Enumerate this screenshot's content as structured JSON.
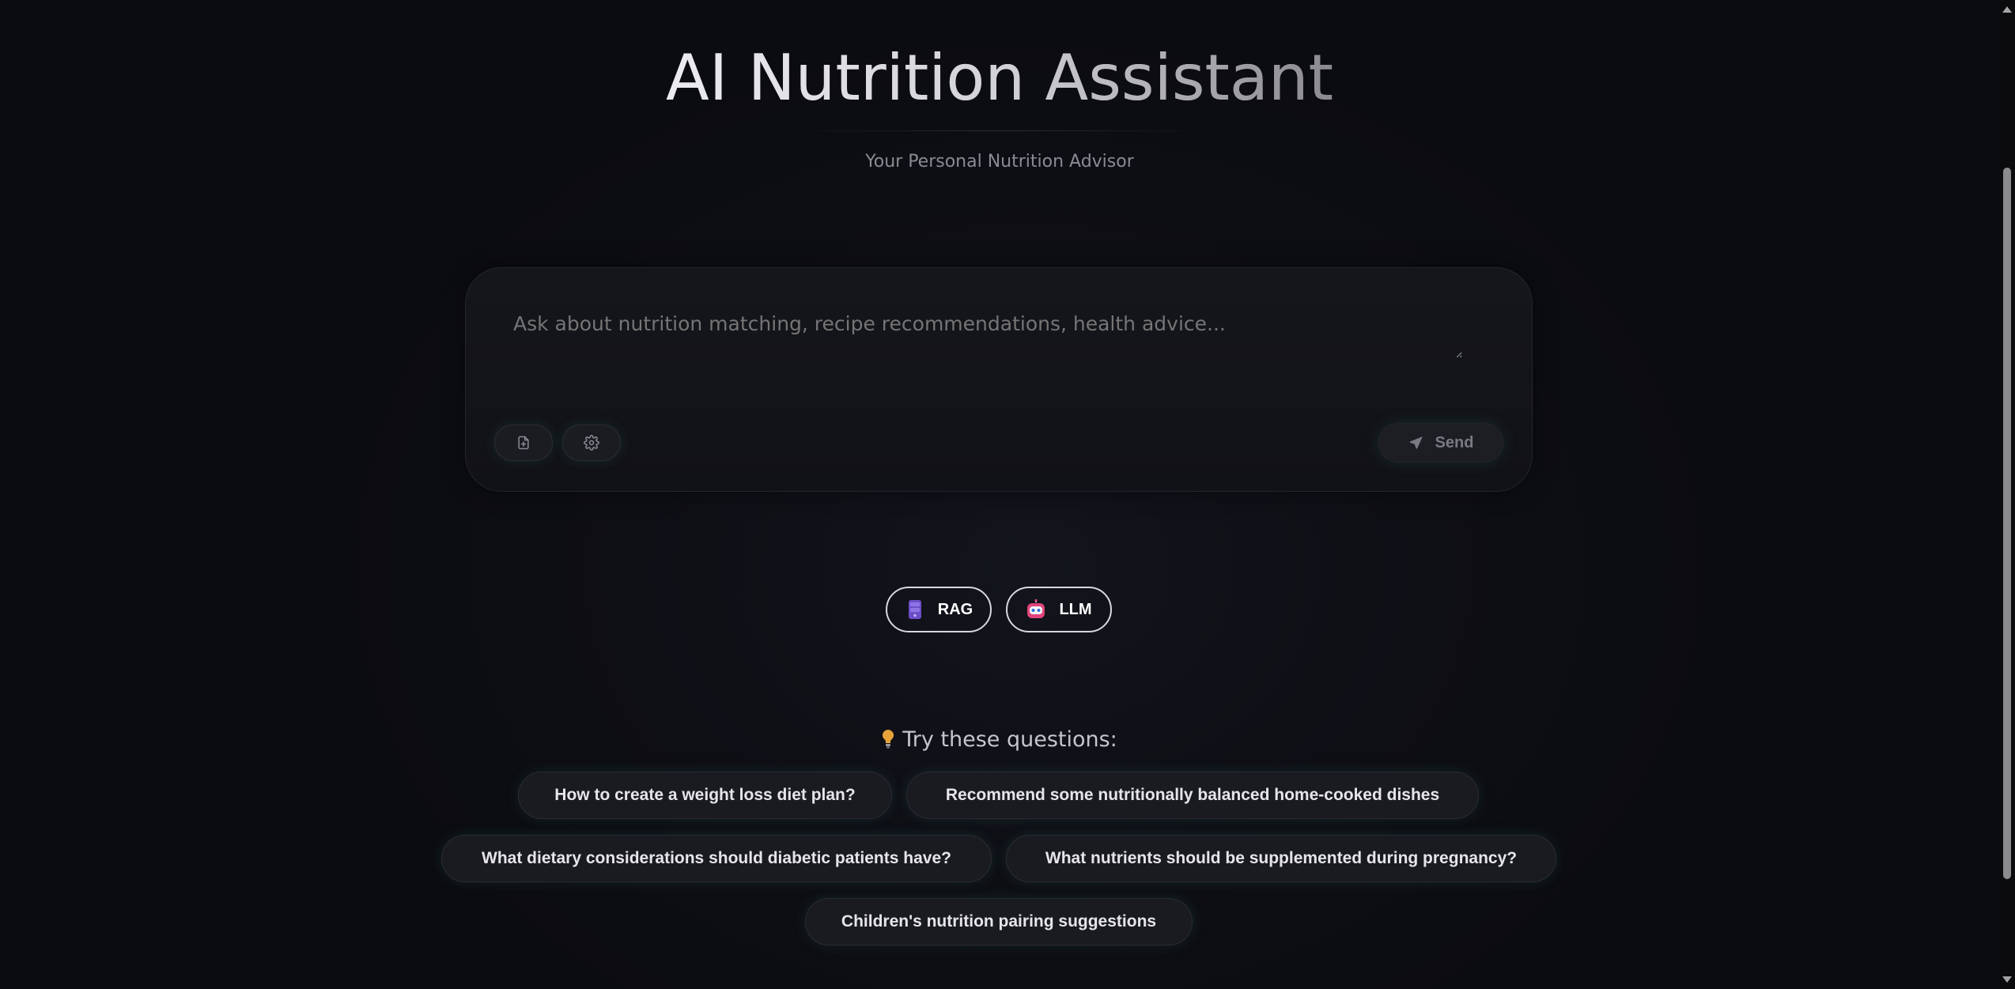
{
  "header": {
    "title": "AI Nutrition Assistant",
    "subtitle": "Your Personal Nutrition Advisor"
  },
  "composer": {
    "placeholder": "Ask about nutrition matching, recipe recommendations, health advice...",
    "upload_icon": "file-plus-icon",
    "settings_icon": "gear-icon",
    "send_label": "Send",
    "send_icon": "paper-plane-icon"
  },
  "modes": [
    {
      "label": "RAG",
      "icon": "database-icon"
    },
    {
      "label": "LLM",
      "icon": "robot-icon"
    }
  ],
  "suggestions": {
    "heading": "Try these questions:",
    "heading_icon": "lightbulb-icon",
    "items": [
      "How to create a weight loss diet plan?",
      "Recommend some nutritionally balanced home-cooked dishes",
      "What dietary considerations should diabetic patients have?",
      "What nutrients should be supplemented during pregnancy?",
      "Children's nutrition pairing suggestions"
    ]
  },
  "colors": {
    "background": "#0b0c10",
    "accent_glow": "#287850",
    "rag_icon": "#7b5ad6",
    "llm_icon": "#e0457b",
    "bulb": "#e6a33a"
  }
}
